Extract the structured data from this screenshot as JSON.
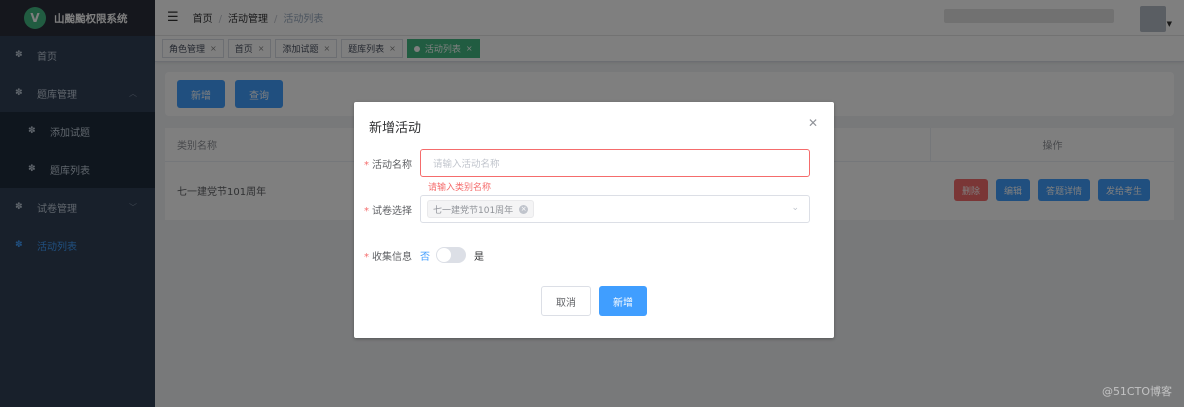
{
  "app": {
    "logo_letter": "V",
    "title": "山颱颱权限系统"
  },
  "sidebar": {
    "items": [
      {
        "label": "首页",
        "icon": "dashboard-icon"
      },
      {
        "label": "题库管理",
        "icon": "dashboard-icon"
      },
      {
        "label": "添加试题",
        "icon": "dashboard-icon"
      },
      {
        "label": "题库列表",
        "icon": "dashboard-icon"
      },
      {
        "label": "试卷管理",
        "icon": "dashboard-icon"
      },
      {
        "label": "活动列表",
        "icon": "dashboard-icon"
      }
    ]
  },
  "header": {
    "breadcrumb": [
      "首页",
      "活动管理",
      "活动列表"
    ]
  },
  "tags": [
    "角色管理",
    "首页",
    "添加试题",
    "题库列表",
    "活动列表"
  ],
  "toolbar": {
    "add_label": "新增",
    "query_label": "查询"
  },
  "table": {
    "columns": [
      "类别名称",
      "操作"
    ],
    "rows": [
      {
        "name": "七一建党节101周年"
      }
    ],
    "actions": [
      "删除",
      "编辑",
      "答题详情",
      "发给考生"
    ]
  },
  "dialog": {
    "title": "新增活动",
    "name_label": "活动名称",
    "name_placeholder": "请输入活动名称",
    "name_error": "请输入类别名称",
    "paper_label": "试卷选择",
    "paper_selected": "七一建党节101周年",
    "collect_label": "收集信息",
    "collect_no": "否",
    "collect_yes": "是",
    "cancel_label": "取消",
    "confirm_label": "新增"
  },
  "watermark": "@51CTO博客",
  "colors": {
    "primary": "#409eff",
    "danger": "#f56c6c",
    "sidebar": "#304156",
    "tag_active": "#42b983"
  }
}
